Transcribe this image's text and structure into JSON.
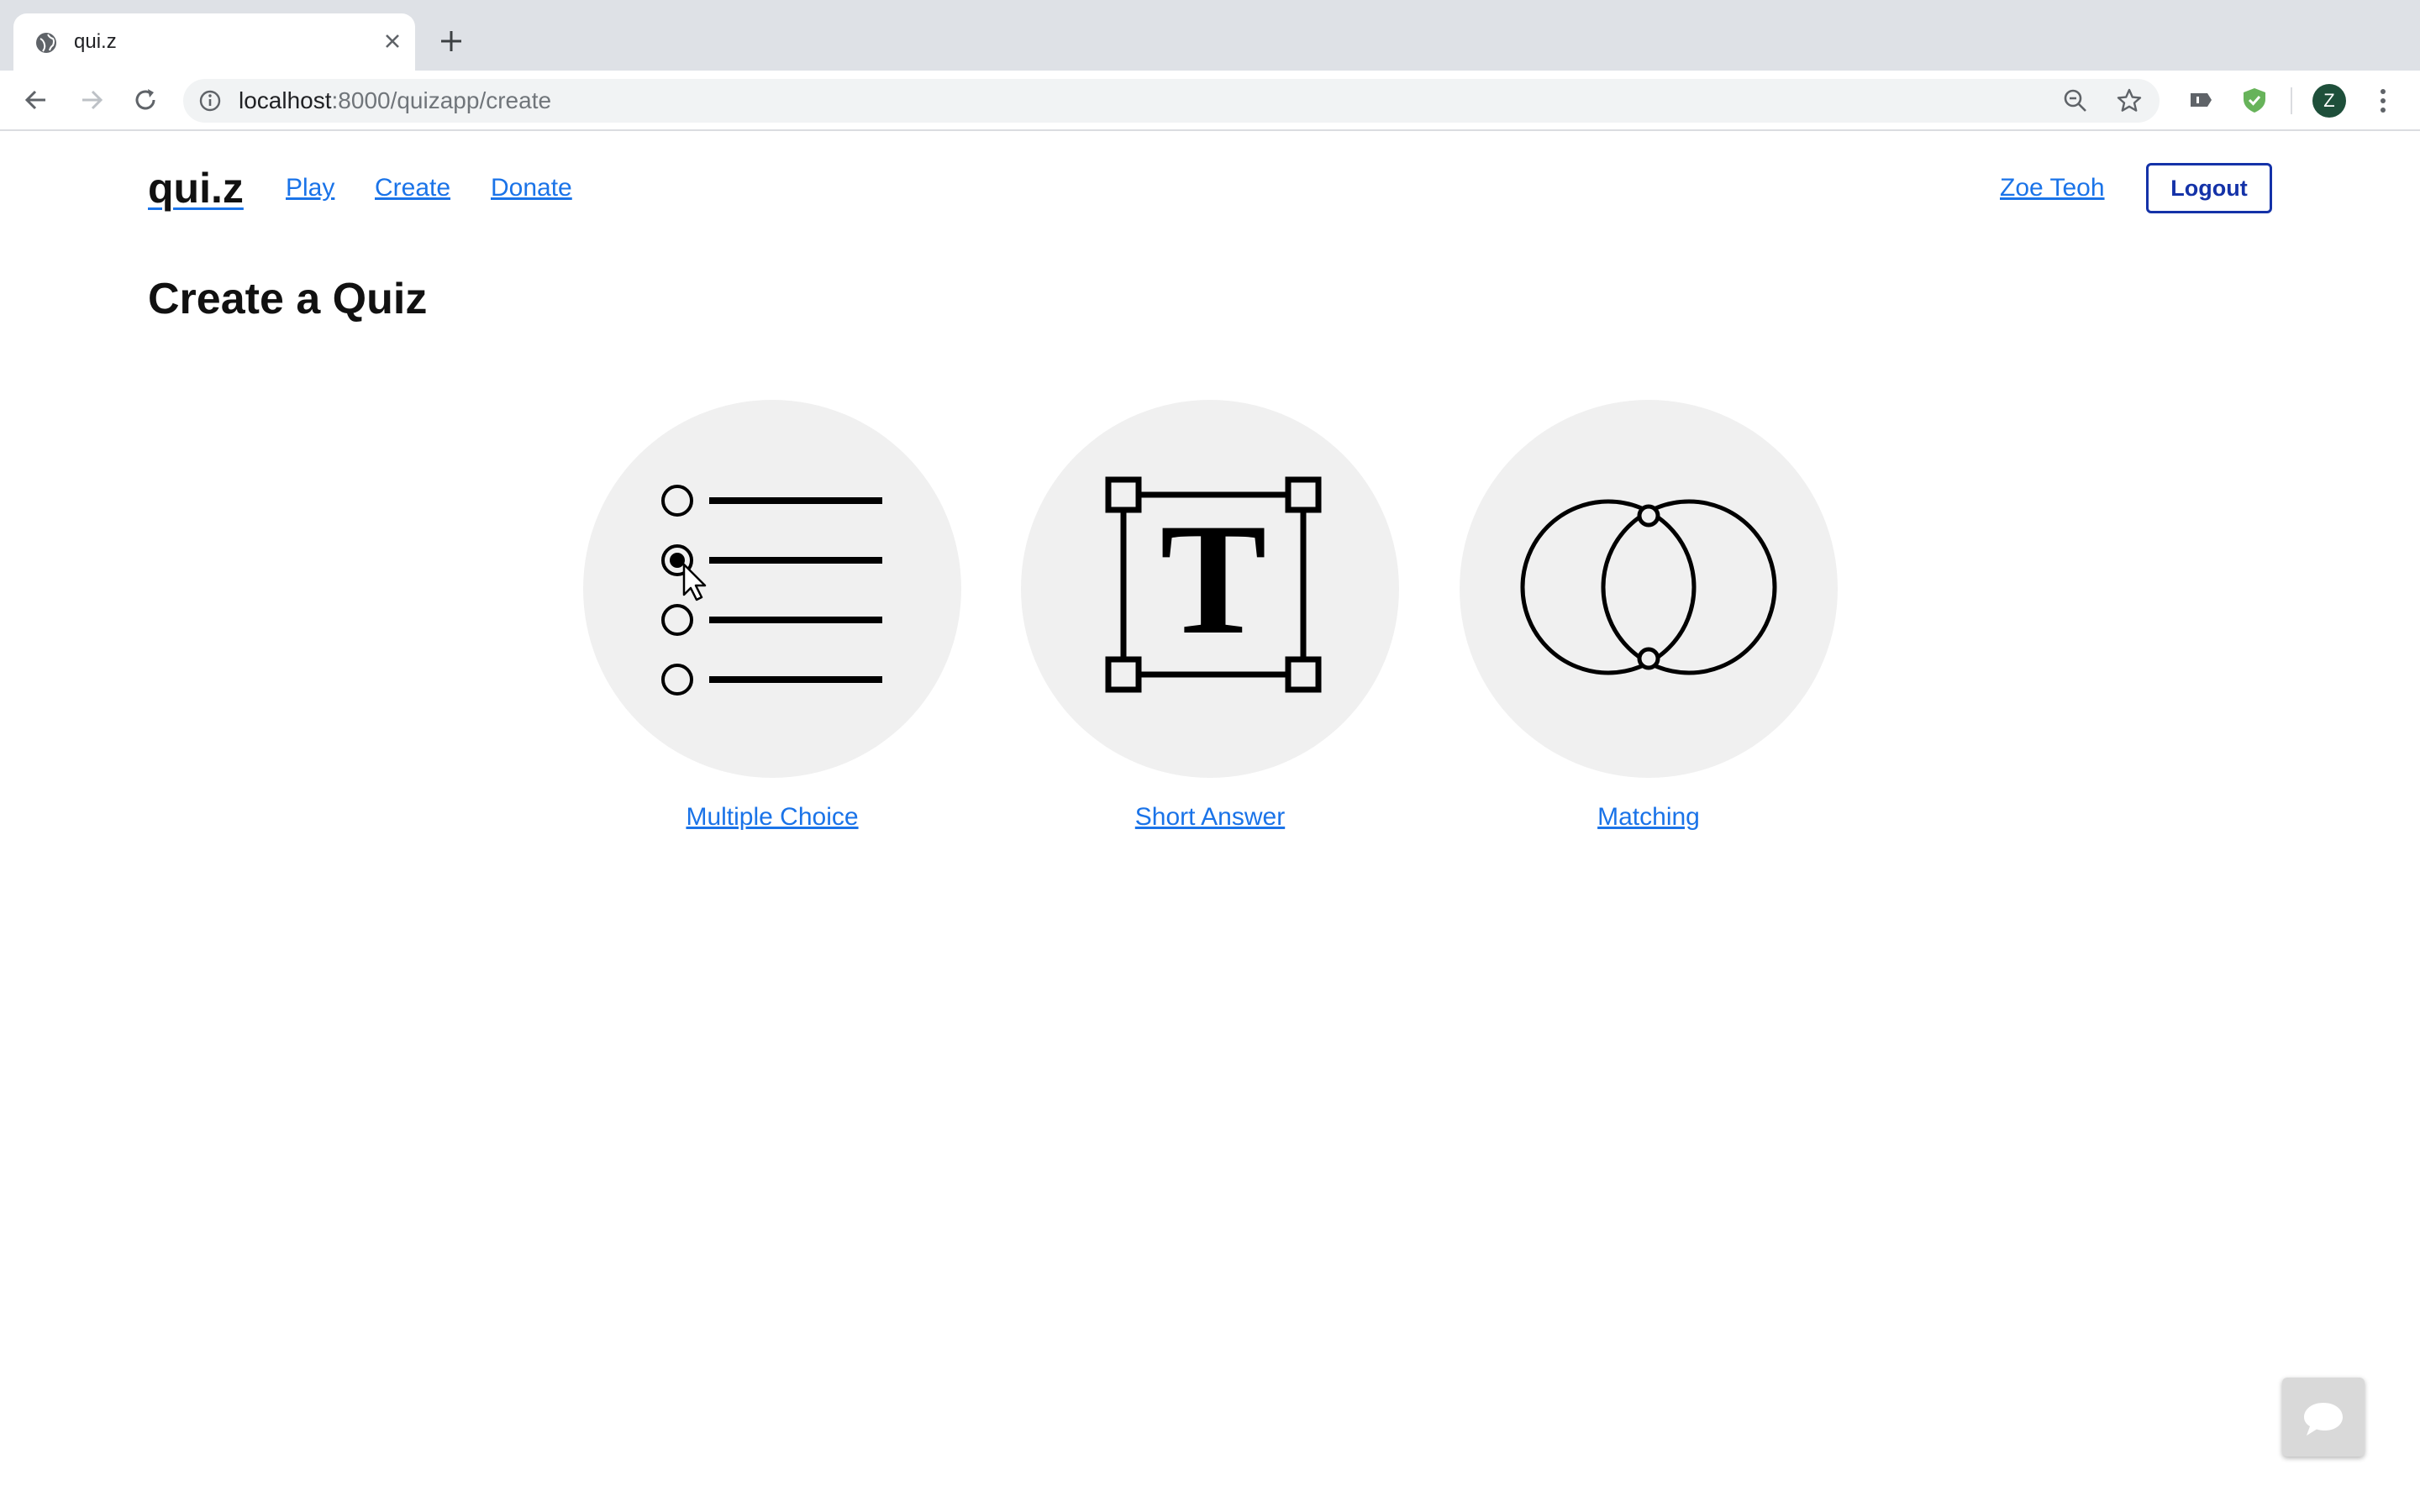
{
  "browser": {
    "tab_title": "qui.z",
    "url_host": "localhost",
    "url_path": ":8000/quizapp/create",
    "profile_initial": "Z"
  },
  "header": {
    "logo": "qui.z",
    "nav": [
      {
        "label": "Play"
      },
      {
        "label": "Create"
      },
      {
        "label": "Donate"
      }
    ],
    "user_name": "Zoe Teoh",
    "logout_label": "Logout"
  },
  "main": {
    "title": "Create a Quiz",
    "quiz_types": [
      {
        "label": "Multiple Choice",
        "icon": "multiple-choice-icon"
      },
      {
        "label": "Short Answer",
        "icon": "text-box-icon"
      },
      {
        "label": "Matching",
        "icon": "matching-icon"
      }
    ]
  },
  "colors": {
    "link": "#1a73e8",
    "logout_border": "#1432a8",
    "circle_bg": "#f0f0f0"
  }
}
